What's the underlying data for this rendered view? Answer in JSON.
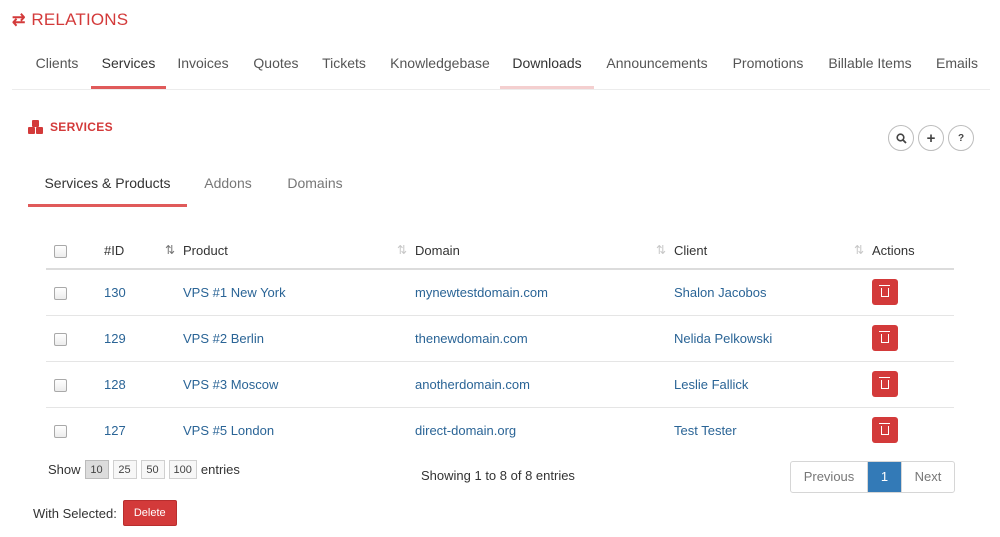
{
  "header": {
    "icon": "exchange-icon",
    "glyph": "⇄",
    "title": "RELATIONS"
  },
  "topnav": [
    "Clients",
    "Services",
    "Invoices",
    "Quotes",
    "Tickets",
    "Knowledgebase",
    "Downloads",
    "Announcements",
    "Promotions",
    "Billable Items",
    "Emails"
  ],
  "active_tab": "Services",
  "hover_tab": "Downloads",
  "section": {
    "icon": "cubes-icon",
    "title": "SERVICES"
  },
  "tools": [
    {
      "name": "search-icon",
      "glyph": "🔍︎"
    },
    {
      "name": "plus-icon",
      "glyph": "+"
    },
    {
      "name": "help-icon",
      "glyph": "?"
    }
  ],
  "subtabs": [
    "Services & Products",
    "Addons",
    "Domains"
  ],
  "table": {
    "headers": {
      "id": "#ID",
      "product": "Product",
      "domain": "Domain",
      "client": "Client",
      "actions": "Actions"
    },
    "rows": [
      {
        "id": "130",
        "product": "VPS #1 New York",
        "domain": "mynewtestdomain.com",
        "client": "Shalon Jacobos"
      },
      {
        "id": "129",
        "product": "VPS #2 Berlin",
        "domain": "thenewdomain.com",
        "client": "Nelida Pelkowski"
      },
      {
        "id": "128",
        "product": "VPS #3 Moscow",
        "domain": "anotherdomain.com",
        "client": "Leslie Fallick"
      },
      {
        "id": "127",
        "product": "VPS #5 London",
        "domain": "direct-domain.org",
        "client": "Test Tester"
      }
    ]
  },
  "length": {
    "show": "Show",
    "options": [
      "10",
      "25",
      "50",
      "100"
    ],
    "selected": "10",
    "entries": "entries"
  },
  "info": "Showing 1 to 8 of 8 entries",
  "pager": {
    "previous": "Previous",
    "current": "1",
    "next": "Next"
  },
  "bulk": {
    "label": "With Selected:",
    "button": "Delete"
  },
  "colors": {
    "accent": "#d33a3a",
    "underline": "#e05a5a",
    "link": "#2a6496",
    "pager_active": "#337ab7"
  }
}
